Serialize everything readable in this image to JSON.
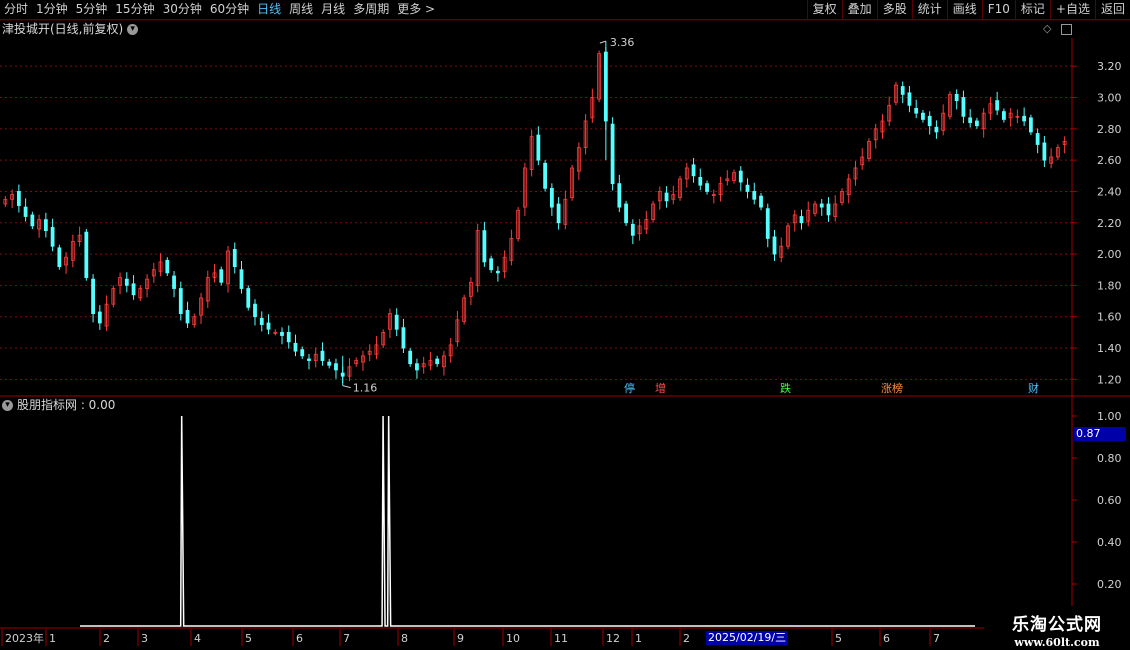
{
  "toolbar": {
    "timeframes": [
      {
        "label": "分时",
        "active": false
      },
      {
        "label": "1分钟",
        "active": false
      },
      {
        "label": "5分钟",
        "active": false
      },
      {
        "label": "15分钟",
        "active": false
      },
      {
        "label": "30分钟",
        "active": false
      },
      {
        "label": "60分钟",
        "active": false
      },
      {
        "label": "日线",
        "active": true
      },
      {
        "label": "周线",
        "active": false
      },
      {
        "label": "月线",
        "active": false
      },
      {
        "label": "多周期",
        "active": false
      },
      {
        "label": "更多 >",
        "active": false
      }
    ],
    "right_buttons": [
      "复权",
      "叠加",
      "多股",
      "统计",
      "画线",
      "F10",
      "+自选",
      "返回"
    ],
    "right_partial": "标记"
  },
  "main_chart": {
    "title": "津投城开(日线,前复权)",
    "y_ticks": [
      "3.20",
      "3.00",
      "2.80",
      "2.60",
      "2.40",
      "2.20",
      "2.00",
      "1.80",
      "1.60",
      "1.40",
      "1.20"
    ],
    "y_tick_values": [
      3.2,
      3.0,
      2.8,
      2.6,
      2.4,
      2.2,
      2.0,
      1.8,
      1.6,
      1.4,
      1.2
    ],
    "high_label": "3.36",
    "low_label": "1.16",
    "event_markers": [
      {
        "text": "停",
        "color": "#4fc3f7"
      },
      {
        "text": "增",
        "color": "#ff5050"
      },
      {
        "text": "跌",
        "color": "#40ff40"
      },
      {
        "text": "涨榜",
        "color": "#ff9040"
      },
      {
        "text": "财",
        "color": "#4fc3f7"
      }
    ]
  },
  "sub_chart": {
    "title": "股朋指标网 : 0.00",
    "y_ticks": [
      "1.00",
      "0.80",
      "0.60",
      "0.40",
      "0.20"
    ],
    "y_tick_values": [
      1.0,
      0.8,
      0.6,
      0.4,
      0.2
    ],
    "current_value": "0.87"
  },
  "x_axis": {
    "labels": [
      "2023年",
      "1",
      "2",
      "3",
      "4",
      "5",
      "6",
      "7",
      "8",
      "9",
      "10",
      "11",
      "12",
      "1",
      "2",
      "5",
      "6",
      "7"
    ],
    "highlight_date": "2025/02/19/三"
  },
  "chart_data": {
    "type": "candlestick",
    "ylim": [
      1.1,
      3.38
    ],
    "close_series": [
      2.35,
      2.38,
      2.31,
      2.24,
      2.18,
      2.22,
      2.15,
      2.05,
      1.92,
      1.98,
      2.08,
      2.12,
      1.85,
      1.62,
      1.56,
      1.68,
      1.78,
      1.85,
      1.8,
      1.74,
      1.78,
      1.84,
      1.9,
      1.95,
      1.88,
      1.78,
      1.62,
      1.56,
      1.6,
      1.72,
      1.85,
      1.88,
      1.82,
      2.02,
      1.92,
      1.78,
      1.66,
      1.6,
      1.55,
      1.52,
      1.5,
      1.48,
      1.44,
      1.38,
      1.35,
      1.32,
      1.36,
      1.32,
      1.29,
      1.26,
      1.22,
      1.28,
      1.32,
      1.35,
      1.38,
      1.42,
      1.5,
      1.62,
      1.52,
      1.4,
      1.3,
      1.26,
      1.3,
      1.32,
      1.3,
      1.35,
      1.42,
      1.58,
      1.72,
      1.82,
      2.15,
      1.95,
      1.9,
      1.88,
      1.98,
      2.1,
      2.28,
      2.55,
      2.75,
      2.6,
      2.42,
      2.3,
      2.2,
      2.35,
      2.55,
      2.68,
      2.85,
      3.0,
      3.28,
      2.85,
      2.45,
      2.3,
      2.2,
      2.12,
      2.18,
      2.22,
      2.32,
      2.4,
      2.34,
      2.38,
      2.48,
      2.55,
      2.5,
      2.44,
      2.4,
      2.38,
      2.45,
      2.48,
      2.52,
      2.46,
      2.4,
      2.35,
      2.3,
      2.1,
      2.0,
      2.05,
      2.18,
      2.25,
      2.2,
      2.28,
      2.32,
      2.3,
      2.25,
      2.32,
      2.4,
      2.48,
      2.55,
      2.62,
      2.72,
      2.8,
      2.85,
      2.95,
      3.08,
      3.02,
      2.95,
      2.9,
      2.86,
      2.82,
      2.78,
      2.9,
      3.02,
      2.98,
      2.88,
      2.84,
      2.82,
      2.9,
      2.96,
      2.92,
      2.86,
      2.9,
      2.88,
      2.85,
      2.78,
      2.7,
      2.6,
      2.62,
      2.68,
      2.72
    ],
    "high_marker": {
      "value": 3.36,
      "index": 89
    },
    "low_marker": {
      "value": 1.16,
      "index": 50
    },
    "indicator_spikes": [
      {
        "start": 0.0,
        "end": 0.0
      },
      {
        "index": 18,
        "value": 1.0
      },
      {
        "index": 54,
        "value": 1.0
      },
      {
        "index": 55,
        "value": 1.0
      }
    ],
    "indicator_spike_positions": [
      18,
      54,
      55
    ],
    "indicator_n": 160
  }
}
